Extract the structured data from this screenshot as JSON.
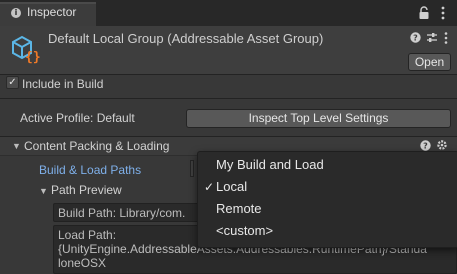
{
  "tab": {
    "label": "Inspector"
  },
  "header": {
    "title": "Default Local Group (Addressable Asset Group)",
    "open_label": "Open"
  },
  "include_in_build": {
    "label": "Include in Build",
    "checked": true
  },
  "active_profile": {
    "label": "Active Profile: Default",
    "button_label": "Inspect Top Level Settings"
  },
  "section": {
    "label": "Content Packing & Loading"
  },
  "build_load_paths": {
    "label": "Build & Load Paths"
  },
  "path_preview": {
    "label": "Path Preview",
    "build_path": "Build Path: Library/com.",
    "load_path_label": "Load Path:",
    "load_path_line1": "{UnityEngine.AddressableAssets.Addressables.RuntimePath}/Standa",
    "load_path_line2": "loneOSX"
  },
  "dropdown": {
    "items": [
      {
        "label": "My Build and Load",
        "checked": false
      },
      {
        "label": "Local",
        "checked": true
      },
      {
        "label": "Remote",
        "checked": false
      },
      {
        "label": "<custom>",
        "checked": false
      }
    ]
  },
  "icons": [
    "info-icon",
    "lock-icon",
    "more-icon",
    "addressable-group-icon",
    "help-icon",
    "presets-icon",
    "kebab-icon",
    "settings-icon",
    "foldout-arrow-icon",
    "checkmark-icon"
  ]
}
